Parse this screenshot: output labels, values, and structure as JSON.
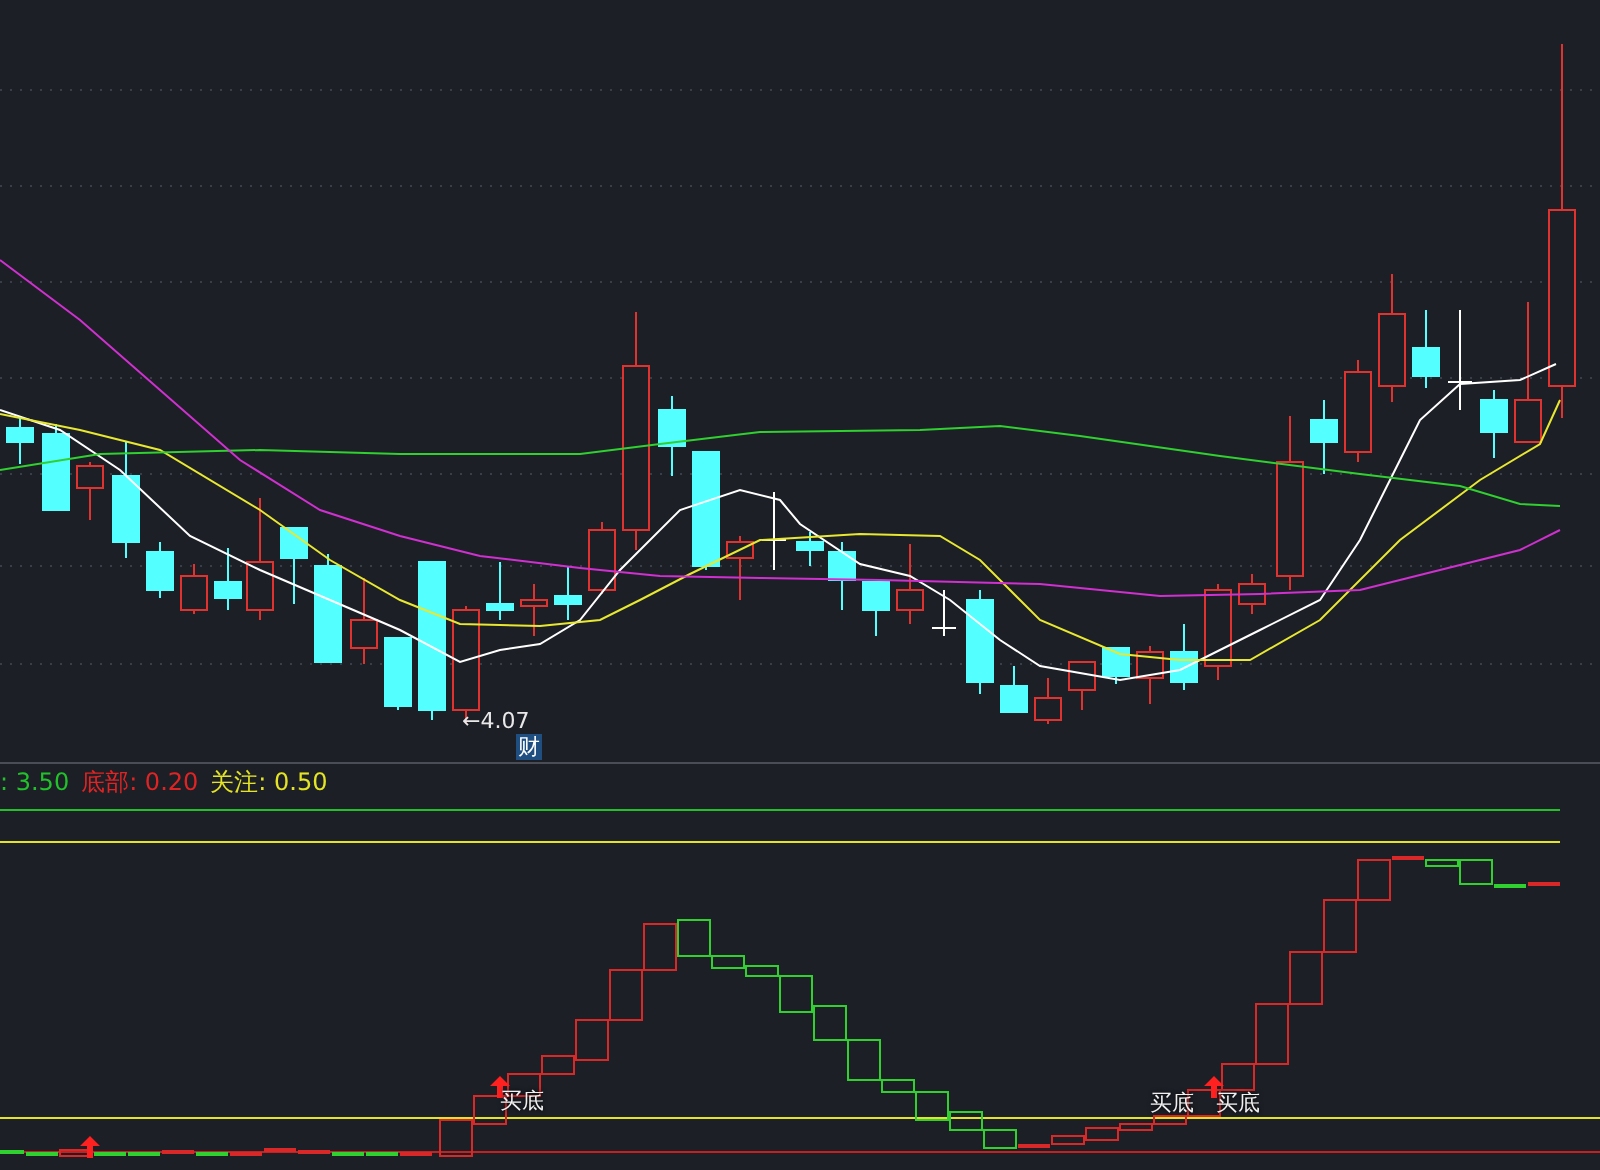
{
  "price_chart": {
    "annotations": [
      {
        "kind": "price",
        "text": "←4.07"
      },
      {
        "kind": "tag",
        "text": "财"
      }
    ]
  },
  "indicator_legend": [
    {
      "text": ": 3.50",
      "color": "#22c02a"
    },
    {
      "text": "底部: 0.20",
      "color": "#e02424"
    },
    {
      "text": "关注: 0.50",
      "color": "#e4e424"
    }
  ],
  "indicator_chart": {
    "signals": [
      {
        "text": "买底"
      },
      {
        "text": "买底"
      },
      {
        "text": "买底"
      }
    ]
  }
}
